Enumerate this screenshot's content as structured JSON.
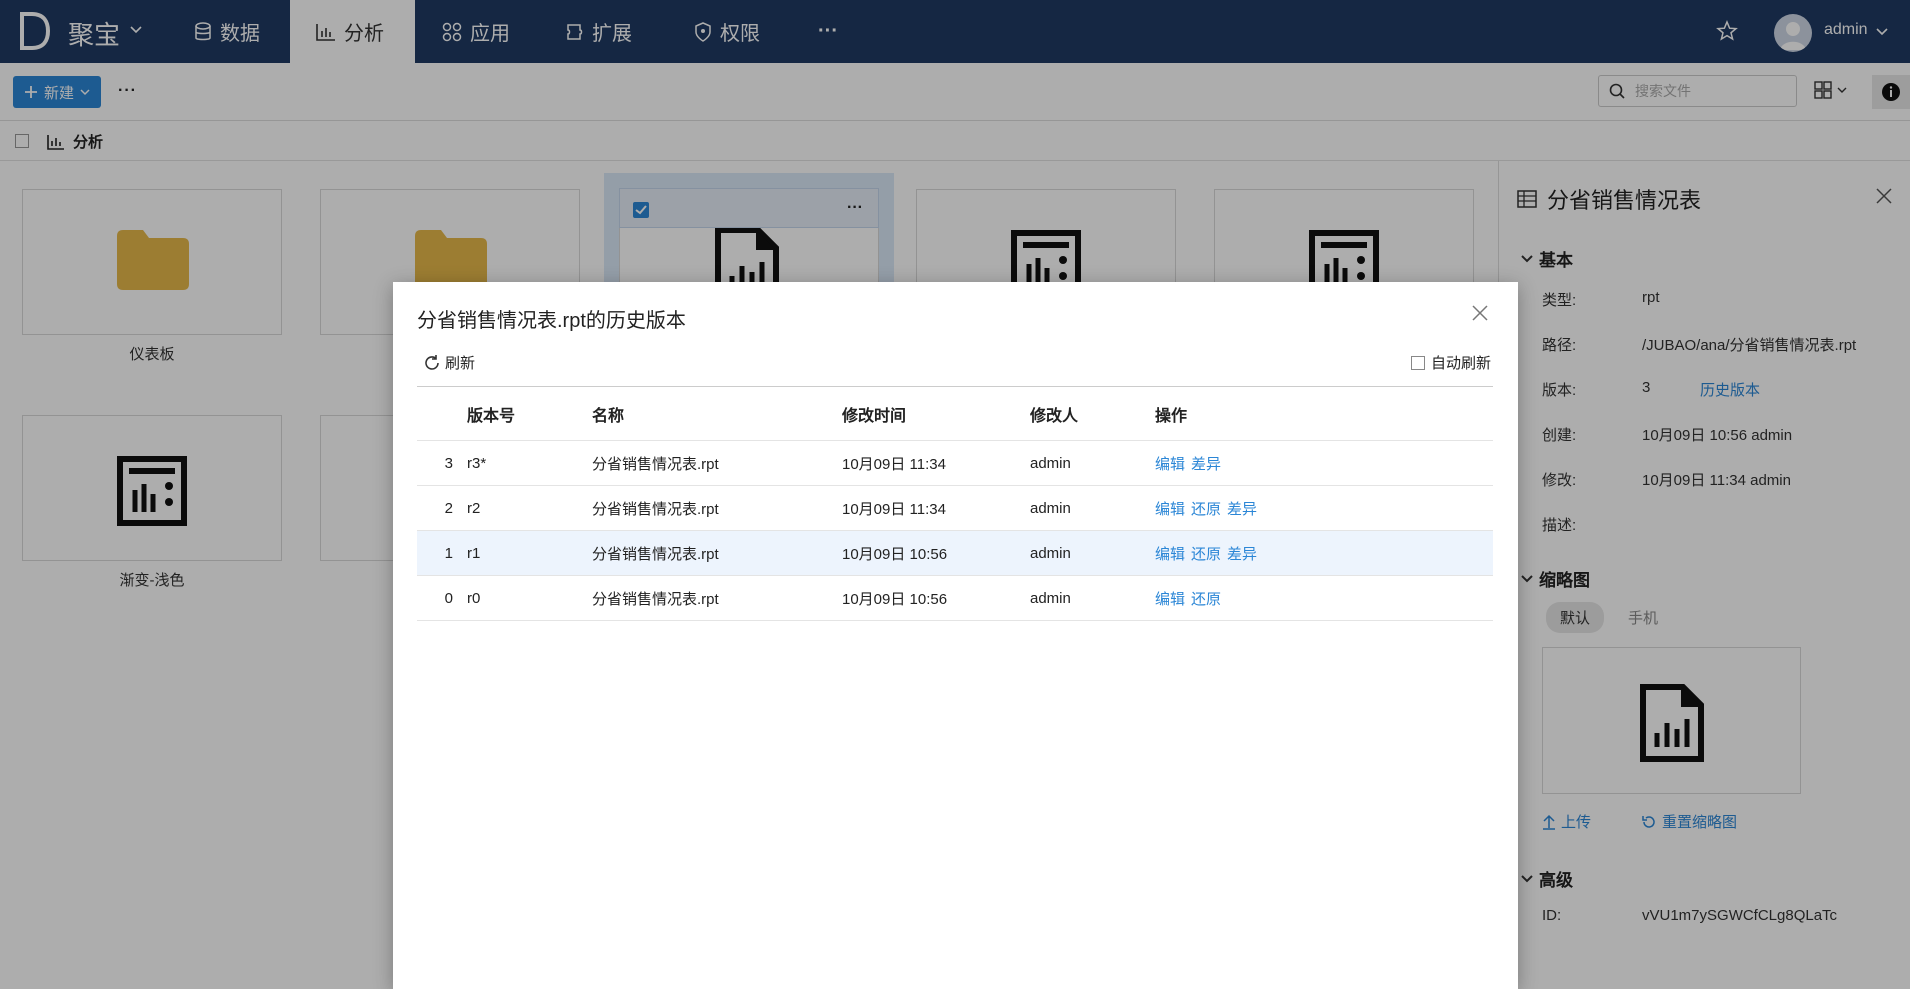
{
  "nav": {
    "brand": "聚宝",
    "items": [
      {
        "label": "数据",
        "icon": "database-icon"
      },
      {
        "label": "分析",
        "icon": "bar-chart-icon",
        "active": true
      },
      {
        "label": "应用",
        "icon": "grid-icon"
      },
      {
        "label": "扩展",
        "icon": "puzzle-icon"
      },
      {
        "label": "权限",
        "icon": "shield-icon"
      }
    ],
    "more": "···",
    "user": "admin"
  },
  "toolbar": {
    "new_label": "新建",
    "more": "···",
    "search_placeholder": "搜索文件"
  },
  "breadcrumb": {
    "label": "分析"
  },
  "cards": [
    {
      "label": "仪表板",
      "icon": "folder-icon"
    },
    {
      "label": "",
      "icon": "folder-icon"
    },
    {
      "label": "",
      "icon": "report-icon",
      "selected": true
    },
    {
      "label": "",
      "icon": "dashboard-report-icon"
    },
    {
      "label": "",
      "icon": "dashboard-report-icon"
    },
    {
      "label": "渐变-浅色",
      "icon": "dashboard-report-icon"
    },
    {
      "label": "",
      "icon": ""
    }
  ],
  "panel": {
    "title": "分省销售情况表",
    "basic_title": "基本",
    "fields": [
      {
        "key": "类型:",
        "value": "rpt"
      },
      {
        "key": "路径:",
        "value": "/JUBAO/ana/分省销售情况表.rpt"
      },
      {
        "key": "版本:",
        "value": "3",
        "link": "历史版本"
      },
      {
        "key": "创建:",
        "value": "10月09日 10:56 admin"
      },
      {
        "key": "修改:",
        "value": "10月09日 11:34 admin"
      },
      {
        "key": "描述:",
        "value": ""
      }
    ],
    "thumb_title": "缩略图",
    "thumb_tabs": [
      "默认",
      "手机"
    ],
    "upload": "上传",
    "reset_thumb": "重置缩略图",
    "advanced_title": "高级",
    "id_key": "ID:",
    "id_value": "vVU1m7ySGWCfCLg8QLaTc"
  },
  "dialog": {
    "title": "分省销售情况表.rpt的历史版本",
    "refresh": "刷新",
    "auto_refresh": "自动刷新",
    "columns": [
      "",
      "版本号",
      "名称",
      "修改时间",
      "修改人",
      "操作"
    ],
    "rows": [
      {
        "idx": "3",
        "version": "r3*",
        "name": "分省销售情况表.rpt",
        "time": "10月09日 11:34",
        "user": "admin",
        "ops": [
          "编辑",
          "差异"
        ]
      },
      {
        "idx": "2",
        "version": "r2",
        "name": "分省销售情况表.rpt",
        "time": "10月09日 11:34",
        "user": "admin",
        "ops": [
          "编辑",
          "还原",
          "差异"
        ]
      },
      {
        "idx": "1",
        "version": "r1",
        "name": "分省销售情况表.rpt",
        "time": "10月09日 10:56",
        "user": "admin",
        "ops": [
          "编辑",
          "还原",
          "差异"
        ],
        "highlight": true
      },
      {
        "idx": "0",
        "version": "r0",
        "name": "分省销售情况表.rpt",
        "time": "10月09日 10:56",
        "user": "admin",
        "ops": [
          "编辑",
          "还原"
        ]
      }
    ]
  },
  "colors": {
    "nav_bg": "#1f3a63",
    "accent": "#2b86d6",
    "folder": "#e6b94a"
  }
}
